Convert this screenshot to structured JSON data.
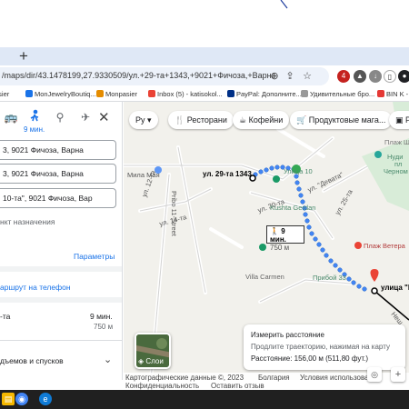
{
  "browser": {
    "url": "/maps/dir/43.1478199,27.9330509/ул.+29-та+1343,+9021+Фичоза,+Варна/43.14...",
    "bookmarks": [
      "asier",
      "MonJewelryBoutiq...",
      "Monpasier",
      "Inbox (5) - katisokol...",
      "PayPal: Дополните...",
      "Удивительные бро...",
      "BIN K -"
    ],
    "extension_badge": "4"
  },
  "panel": {
    "travel_time_tab": "9 мин.",
    "waypoints": [
      "3, 9021 Фичоза, Варна",
      "3, 9021 Фичоза, Варна",
      "10-та\", 9021 Фичоза, Вар"
    ],
    "add_destination": "нкт назначения",
    "options": "Параметры",
    "send_to_phone": "аршрут на телефон",
    "route_name": "-та",
    "route_time": "9 мин.",
    "route_distance": "750 м",
    "steps_label": "дъемов и спусков"
  },
  "map": {
    "chips": [
      "Ру",
      "Ресторани",
      "Кофейни",
      "Продуктовые мага...",
      "Р"
    ],
    "labels": {
      "start_address": "ул. 29-та 1343",
      "destination_street": "улица \"Пр",
      "street_mila": "Мила Мая",
      "street_pribo": "Pribo 11-Street",
      "street_12": "ул. 12-та",
      "street_14": "ул. 14-та",
      "street_30": "ул. 30-та",
      "street_25": "ул. 25-та",
      "street_devata": "ул. \"Девата\"",
      "street_nesh": "Неш...",
      "plaz_shev": "Плаж Шев",
      "nudi": "Нуди",
      "pl": "пл",
      "cherno": "Черном",
      "str_10": "Улица 10",
      "kushta": "Kushta Gerdan",
      "plaz_veter": "Плаж Ветера",
      "villa": "Villa Carmen",
      "priboy": "Прибой 33"
    },
    "time_box": {
      "time": "9 мин.",
      "distance": "750 м"
    },
    "layers_label": "Слои",
    "measure": {
      "title": "Измерить расстояние",
      "hint": "Продлите траекторию, нажимая на карту",
      "distance": "Расстояние: 156,00 м (511,80 фут.)"
    },
    "attribution": {
      "data": "Картографические данные ©, 2023",
      "country": "Болгария",
      "terms": "Условия использования",
      "privacy": "Конфиденциальность",
      "feedback": "Оставить отзыв"
    }
  },
  "colors": {
    "route_blue": "#4285f4",
    "accent_link": "#1a73e8",
    "destination_pin": "#ea4335",
    "taskbar": "#202020"
  }
}
